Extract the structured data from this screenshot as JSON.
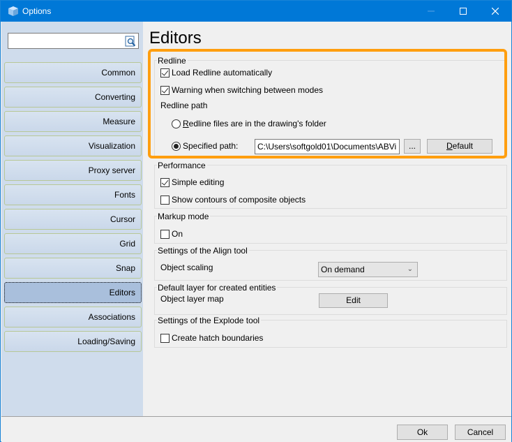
{
  "window": {
    "title": "Options",
    "controls": {
      "minimize": "minimize",
      "maximize": "maximize",
      "close": "close"
    }
  },
  "sidebar": {
    "search": {
      "value": "",
      "placeholder": ""
    },
    "items": [
      {
        "label": "Common",
        "active": false
      },
      {
        "label": "Converting",
        "active": false
      },
      {
        "label": "Measure",
        "active": false
      },
      {
        "label": "Visualization",
        "active": false
      },
      {
        "label": "Proxy server",
        "active": false
      },
      {
        "label": "Fonts",
        "active": false
      },
      {
        "label": "Cursor",
        "active": false
      },
      {
        "label": "Grid",
        "active": false
      },
      {
        "label": "Snap",
        "active": false
      },
      {
        "label": "Editors",
        "active": true
      },
      {
        "label": "Associations",
        "active": false
      },
      {
        "label": "Loading/Saving",
        "active": false
      }
    ]
  },
  "main": {
    "title": "Editors",
    "highlight_color": "#ff9e0f",
    "redline": {
      "label": "Redline",
      "load_auto": {
        "label": "Load Redline automatically",
        "checked": true
      },
      "warning": {
        "label": "Warning when switching between modes",
        "checked": true
      },
      "path_label": "Redline path",
      "radio_drawing_folder": {
        "label_prefix": "R",
        "label_rest": "edline files are in the drawing's folder",
        "checked": false
      },
      "radio_specified": {
        "label": "Specified path:",
        "checked": true
      },
      "path_value": "C:\\Users\\softgold01\\Documents\\ABVi",
      "browse_label": "...",
      "default_prefix": "D",
      "default_rest": "efault"
    },
    "performance": {
      "label": "Performance",
      "simple_editing": {
        "label": "Simple editing",
        "checked": true
      },
      "show_contours": {
        "label": "Show contours of composite objects",
        "checked": false
      }
    },
    "markup": {
      "label": "Markup mode",
      "on": {
        "label": "On",
        "checked": false
      }
    },
    "align": {
      "label": "Settings of the Align tool",
      "scaling_label": "Object scaling",
      "scaling_value": "On demand"
    },
    "layer": {
      "label": "Default layer for created entities",
      "map_label": "Object layer map",
      "edit_label": "Edit"
    },
    "explode": {
      "label": "Settings of the Explode tool",
      "hatch": {
        "label": "Create hatch boundaries",
        "checked": false
      }
    }
  },
  "footer": {
    "ok_label": "Ok",
    "cancel_label": "Cancel"
  }
}
